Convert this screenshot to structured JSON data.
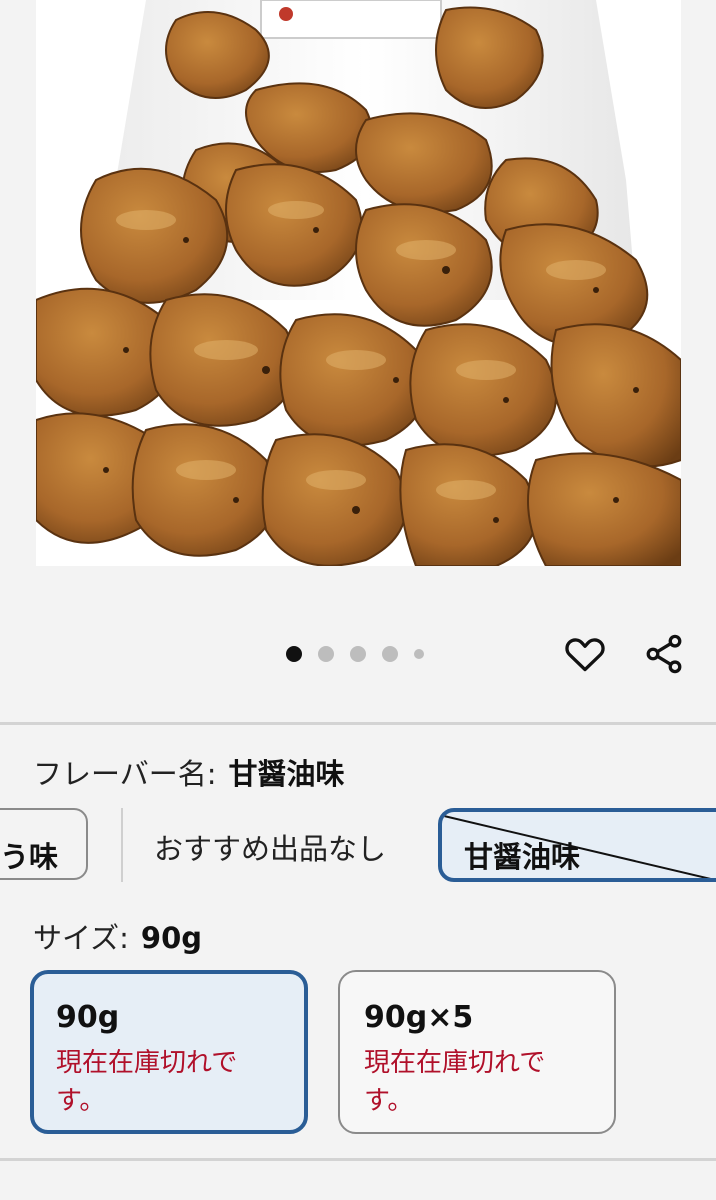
{
  "carousel": {
    "image_description": "fried snack chips",
    "dot_count": 5,
    "active_index": 0
  },
  "actions": {
    "favorite_icon": "heart-icon",
    "share_icon": "share-icon"
  },
  "flavor": {
    "label": "フレーバー名:",
    "selected_value": "甘醤油味",
    "options": {
      "previous_partial": "う味",
      "no_offer": "おすすめ出品なし",
      "selected": "甘醤油味"
    }
  },
  "size": {
    "label": "サイズ:",
    "selected_value": "90g",
    "options": [
      {
        "name": "90g",
        "status": "現在在庫切れです。",
        "selected": true
      },
      {
        "name": "90g×5",
        "status": "現在在庫切れです。",
        "selected": false
      }
    ]
  },
  "colors": {
    "accent_border": "#2a5d96",
    "selected_bg": "#e6eef6",
    "out_of_stock_text": "#b0102a"
  }
}
